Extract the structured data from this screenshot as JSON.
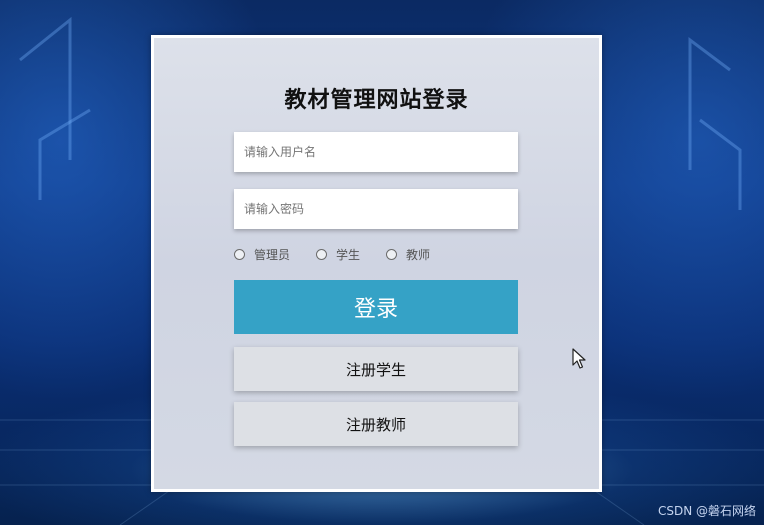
{
  "page": {
    "title": "教材管理网站登录"
  },
  "form": {
    "username_placeholder": "请输入用户名",
    "password_placeholder": "请输入密码",
    "roles": [
      {
        "label": "管理员"
      },
      {
        "label": "学生"
      },
      {
        "label": "教师"
      }
    ],
    "login_label": "登录",
    "register_student_label": "注册学生",
    "register_teacher_label": "注册教师"
  },
  "watermark": "CSDN @磐石网络",
  "colors": {
    "login_button": "#35a2c6",
    "card_background": "#d4d9e4",
    "register_button": "#dde0e5",
    "page_background": "#0d3580"
  },
  "icons": {
    "cursor": "mouse-pointer-icon"
  }
}
